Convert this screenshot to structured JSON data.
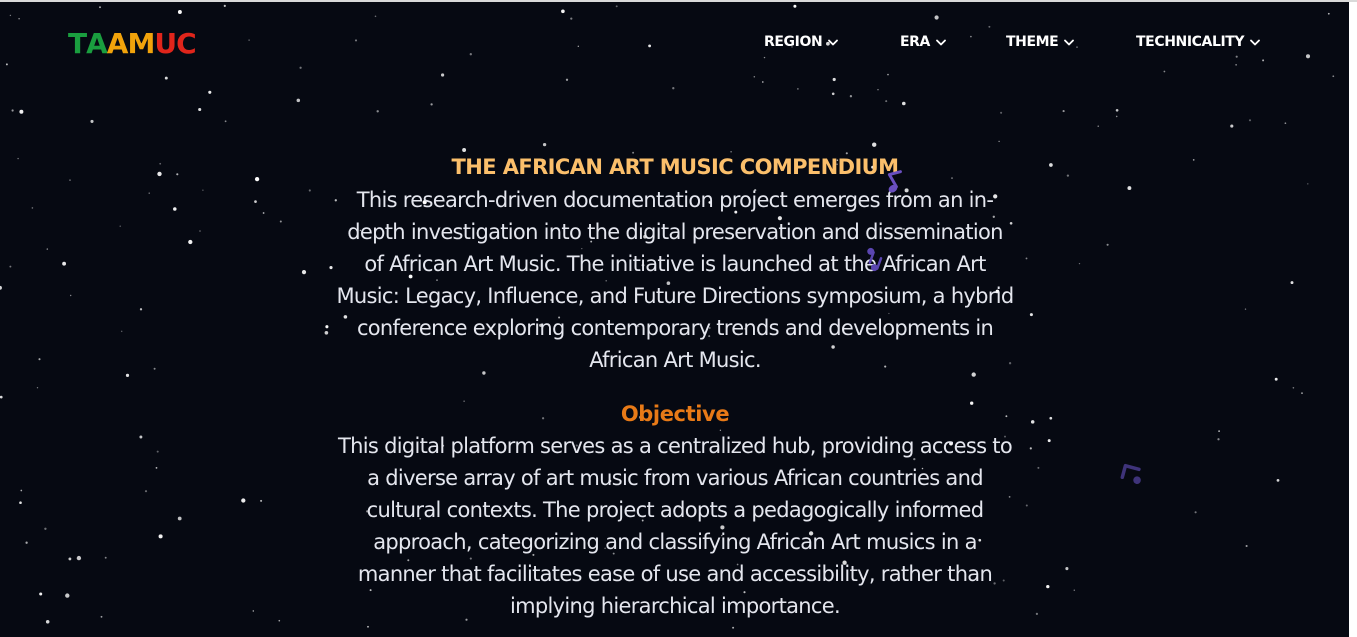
{
  "logo": {
    "letters": [
      {
        "char": "T",
        "color": "#1a9e3f"
      },
      {
        "char": "A",
        "color": "#1a9e3f"
      },
      {
        "char": "A",
        "color": "#f1a30b"
      },
      {
        "char": "M",
        "color": "#f1a30b"
      },
      {
        "char": "U",
        "color": "#e0251b"
      },
      {
        "char": "C",
        "color": "#e0251b"
      }
    ],
    "text": "TAAMUC"
  },
  "nav": {
    "items": [
      {
        "label": "REGION",
        "icon": "chevron-down-icon"
      },
      {
        "label": "ERA",
        "icon": "chevron-down-icon"
      },
      {
        "label": "THEME",
        "icon": "chevron-down-icon"
      },
      {
        "label": "TECHNICALITY",
        "icon": "chevron-down-icon"
      }
    ]
  },
  "main": {
    "title": "THE AFRICAN ART MUSIC COMPENDIUM",
    "intro": "This research-driven documentation project emerges from an in-depth investigation into the digital preservation and dissemination of African Art Music. The initiative is launched at the African Art Music: Legacy, Influence, and Future Directions symposium, a hybrid conference exploring contemporary trends and developments in African Art Music.",
    "objective_heading": "Objective",
    "objective_text": "This digital platform serves as a centralized hub, providing access to a diverse array of art music from various African countries and cultural contexts. The project adopts a pedagogically informed approach, categorizing and classifying African Art musics in a manner that facilitates ease of use and accessibility, rather than implying hierarchical importance."
  },
  "theme": {
    "background": "#060912",
    "title_color": "#fbbf6b",
    "objective_color": "#e87a17",
    "text_color": "#e4e6ee",
    "note_color": "#6a4fc0",
    "star_color": "#ffffff"
  },
  "decorations": {
    "background_icon": "star-field",
    "floating_icons": [
      "music-note-icon",
      "music-note-icon",
      "music-note-icon"
    ]
  }
}
